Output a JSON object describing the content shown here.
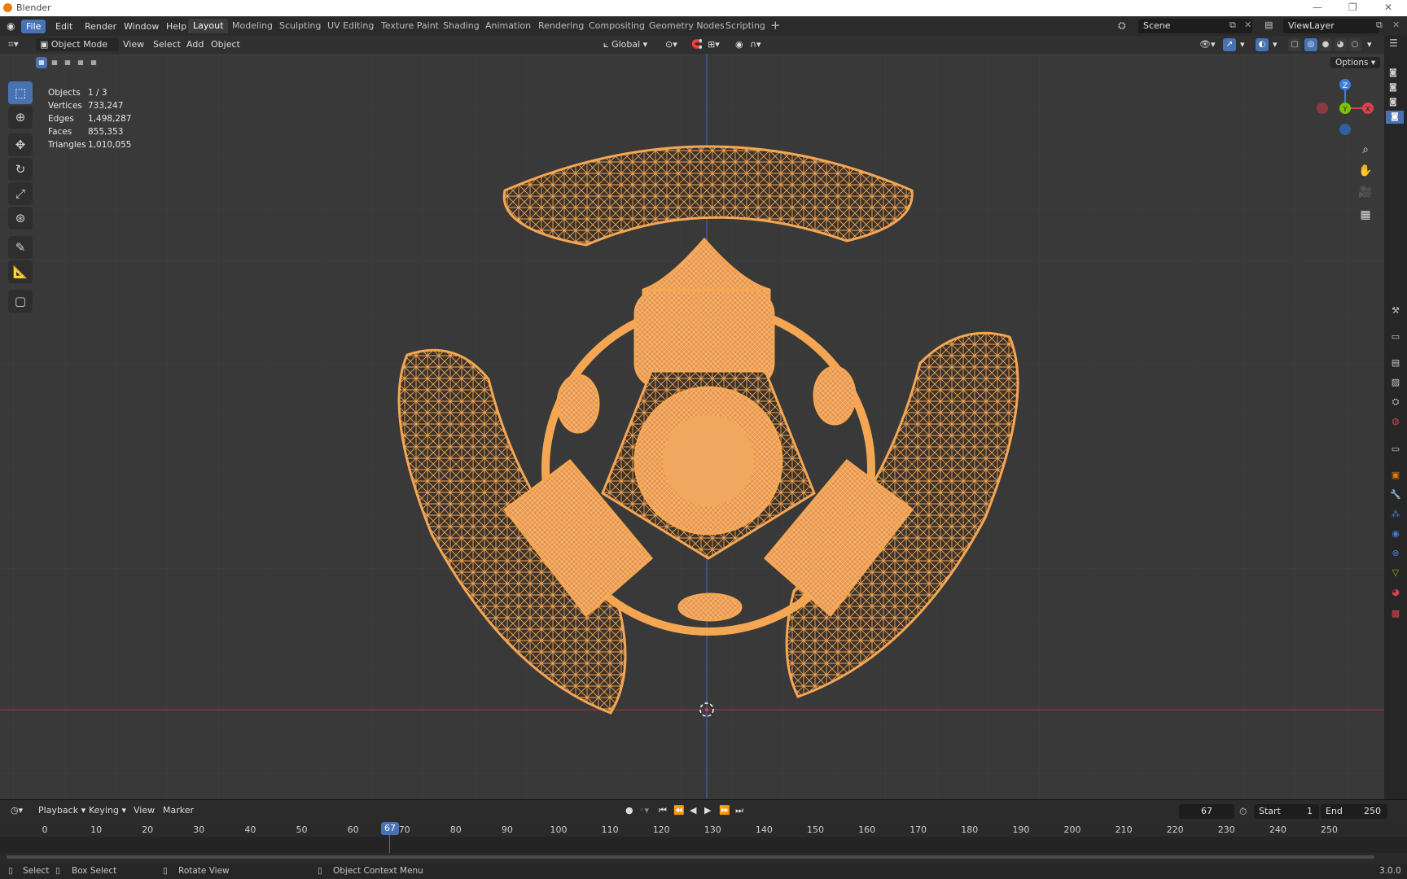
{
  "window": {
    "title": "Blender",
    "version": "3.0.0"
  },
  "menu": [
    "File",
    "Edit",
    "Render",
    "Window",
    "Help"
  ],
  "workspaces": [
    "Layout",
    "Modeling",
    "Sculpting",
    "UV Editing",
    "Texture Paint",
    "Shading",
    "Animation",
    "Rendering",
    "Compositing",
    "Geometry Nodes",
    "Scripting"
  ],
  "active_workspace": "Layout",
  "scene": {
    "name": "Scene",
    "view_layer": "ViewLayer"
  },
  "viewport_header": {
    "mode": "Object Mode",
    "menus": [
      "View",
      "Select",
      "Add",
      "Object"
    ],
    "transform_orientation": "Global",
    "options": "Options"
  },
  "stats": [
    {
      "label": "Objects",
      "value": "1 / 3"
    },
    {
      "label": "Vertices",
      "value": "733,247"
    },
    {
      "label": "Edges",
      "value": "1,498,287"
    },
    {
      "label": "Faces",
      "value": "855,353"
    },
    {
      "label": "Triangles",
      "value": "1,010,055"
    }
  ],
  "gizmo": {
    "z": "Z",
    "y": "Y",
    "x": "X"
  },
  "timeline": {
    "menus": [
      "Playback",
      "Keying",
      "View",
      "Marker"
    ],
    "current_frame": "67",
    "start_label": "Start",
    "start": "1",
    "end_label": "End",
    "end": "250",
    "ticks": [
      "0",
      "10",
      "20",
      "30",
      "40",
      "50",
      "60",
      "70",
      "80",
      "90",
      "100",
      "110",
      "120",
      "130",
      "140",
      "150",
      "160",
      "170",
      "180",
      "190",
      "200",
      "210",
      "220",
      "230",
      "240",
      "250"
    ]
  },
  "statusbar": {
    "select": "Select",
    "box_select": "Box Select",
    "rotate_view": "Rotate View",
    "context_menu": "Object Context Menu"
  },
  "colors": {
    "accent": "#4772b3",
    "selection": "#f5a653",
    "x_axis": "#d9424e",
    "y_axis": "#7cc400",
    "z_axis": "#3d7ed6"
  }
}
